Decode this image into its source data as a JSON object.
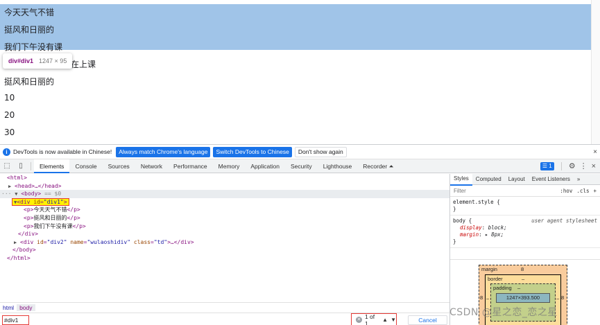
{
  "viewport": {
    "lines": [
      "今天天气不错",
      "挺风和日丽的",
      "我们下午没有课",
      "我在上课",
      "挺风和日丽的",
      "10",
      "20",
      "30"
    ]
  },
  "tooltip": {
    "tag": "div#div1",
    "size": "1247 × 95"
  },
  "infobar": {
    "text": "DevTools is now available in Chinese!",
    "btn_match": "Always match Chrome's language",
    "btn_switch": "Switch DevTools to Chinese",
    "btn_dont": "Don't show again",
    "close": "×"
  },
  "tabs": [
    "Elements",
    "Console",
    "Sources",
    "Network",
    "Performance",
    "Memory",
    "Application",
    "Security",
    "Lighthouse",
    "Recorder ⏶"
  ],
  "issues_count": "1",
  "dom": {
    "html_open": "<html>",
    "head": "<head>…</head>",
    "body_open": "<body>",
    "body_marker": "== $0",
    "div1_tag": "div",
    "div1_attr": "id",
    "div1_val": "\"div1\"",
    "p1": "今天天气不错",
    "p2": "挺风和日丽的",
    "p3": "我们下午没有课",
    "div_close": "</div>",
    "div2_tag": "div",
    "div2_attr1": "id",
    "div2_val1": "\"div2\"",
    "div2_attr2": "name",
    "div2_val2": "\"wulaoshidiv\"",
    "div2_attr3": "class",
    "div2_val3": "\"td\"",
    "div2_rest": ">…</div>",
    "body_close": "</body>",
    "html_close": "</html>"
  },
  "breadcrumbs": [
    "html",
    "body"
  ],
  "search": {
    "value": "#div1",
    "matches": "1 of 1",
    "cancel": "Cancel"
  },
  "styles": {
    "tabs": [
      "Styles",
      "Computed",
      "Layout",
      "Event Listeners",
      "»"
    ],
    "filter_placeholder": "Filter",
    "hov": ":hov",
    "cls": ".cls",
    "plus": "+",
    "element_style": "element.style {",
    "brace_close": "}",
    "body_selector": "body {",
    "body_source": "user agent stylesheet",
    "prop1": "display",
    "val1": "block;",
    "prop2": "margin",
    "val2": "▸ 8px;"
  },
  "box_model": {
    "margin_label": "margin",
    "margin_val": "8",
    "border_label": "border",
    "border_val": "–",
    "padding_label": "padding",
    "padding_val": "–",
    "content": "1247×393.500",
    "left_margin": "8",
    "right_margin": "8",
    "left_dash": "–",
    "right_dash": "–"
  },
  "watermark": "CSDN @星之恋_恋之星",
  "colors": {
    "accent": "#1a73e8",
    "highlight": "#a0c4e8",
    "tag": "#881280",
    "attr": "#994500",
    "attrval": "#1a1aa6"
  }
}
